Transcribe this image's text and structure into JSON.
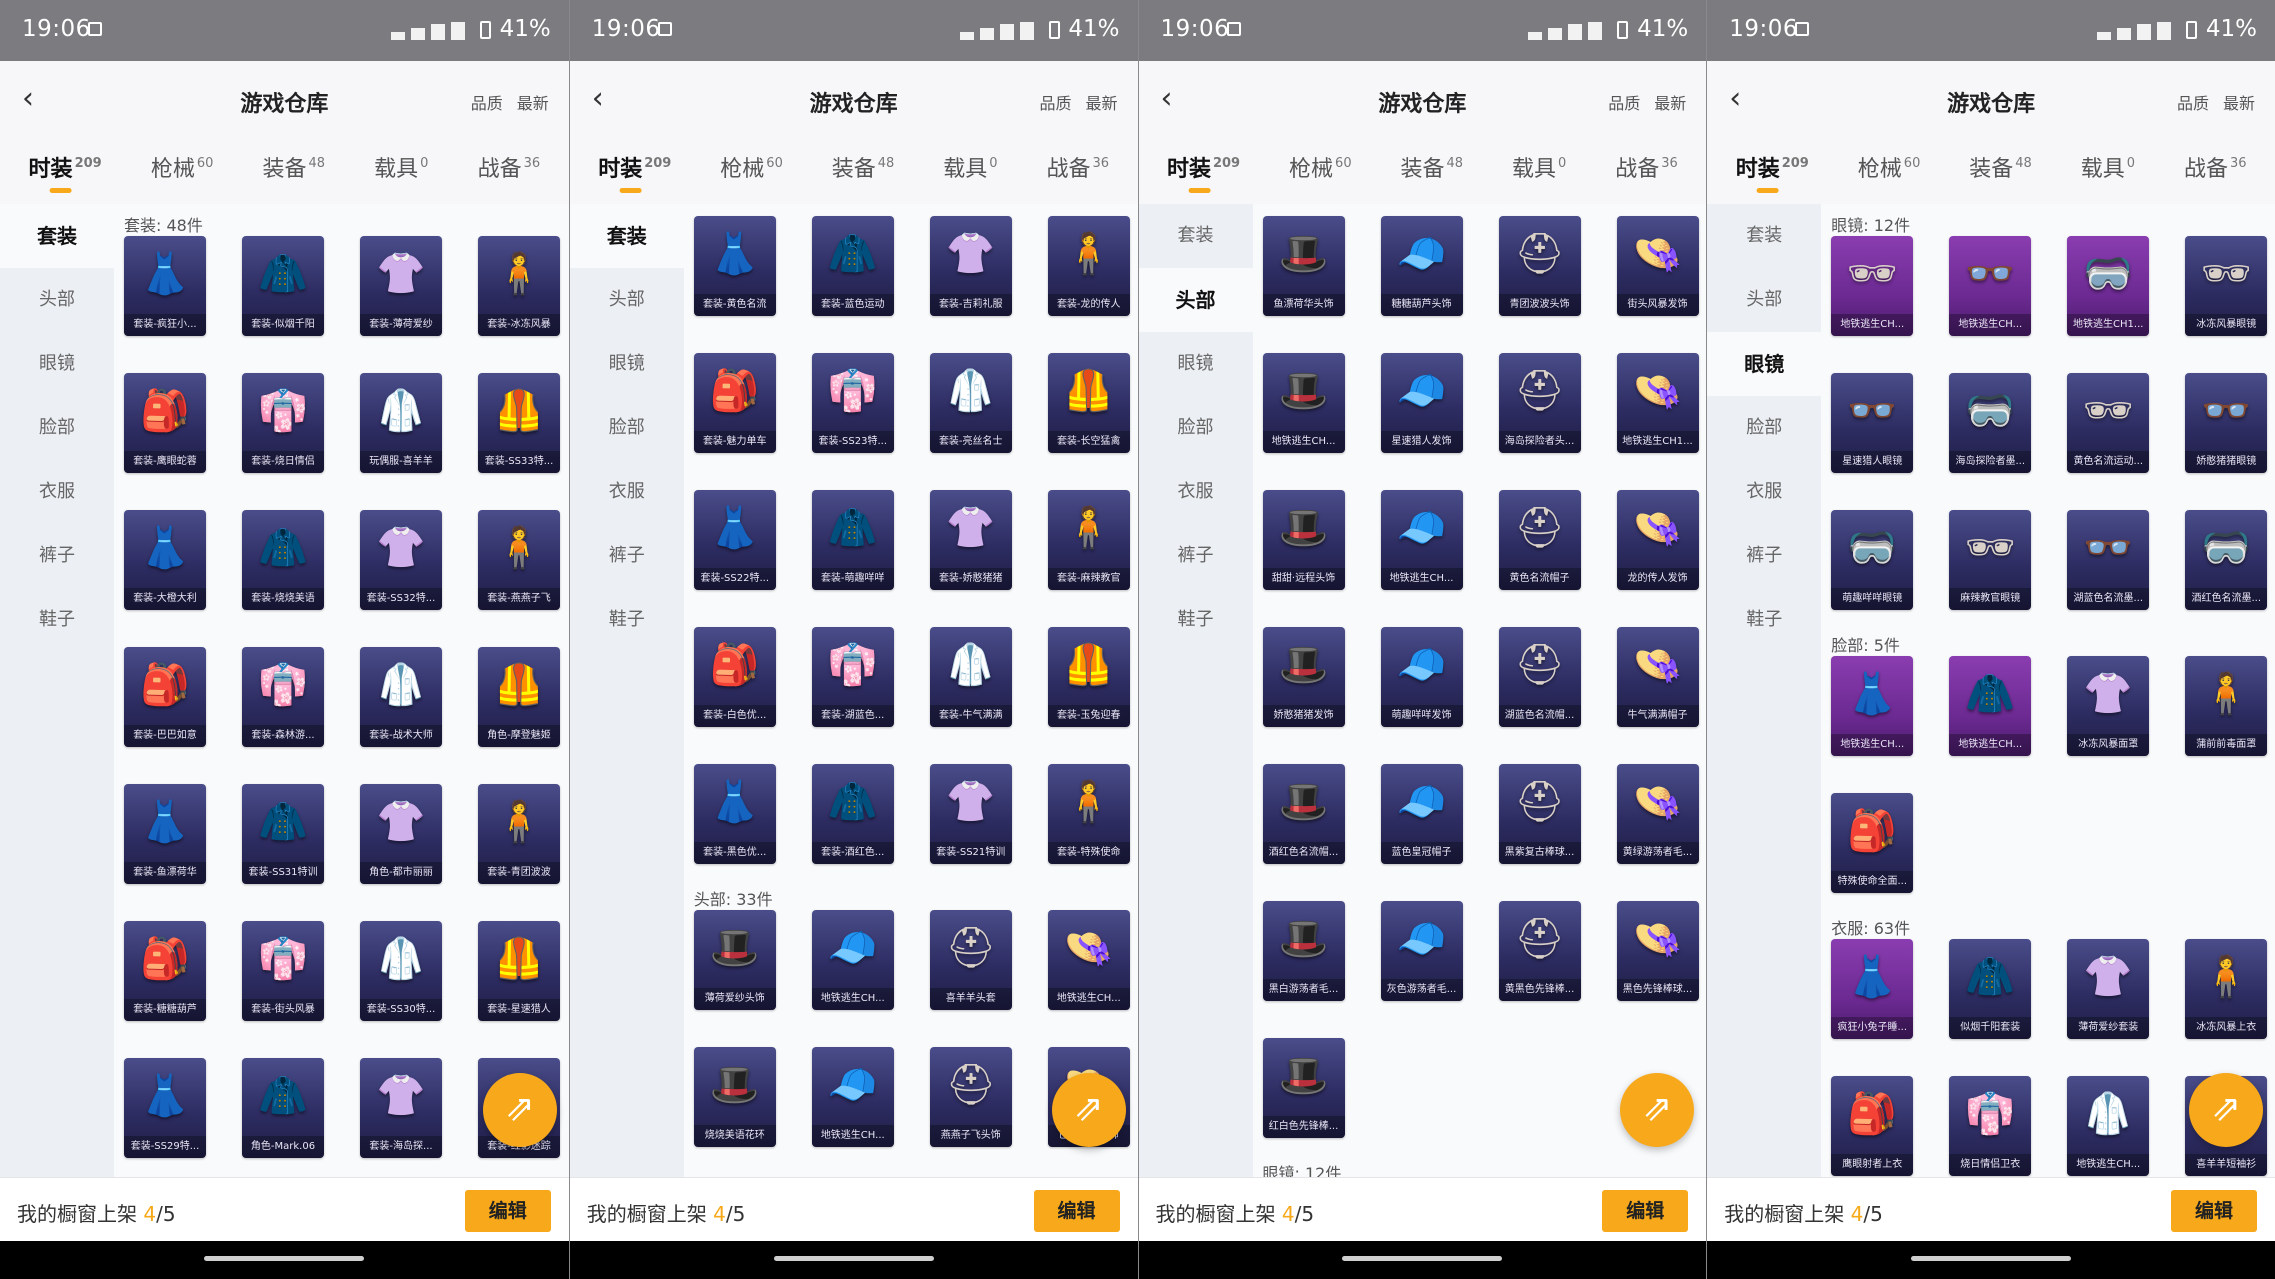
{
  "status": {
    "time": "19:06",
    "battery": "41%"
  },
  "header": {
    "title": "游戏仓库",
    "sort_quality": "品质",
    "sort_newest": "最新"
  },
  "tabs": [
    {
      "label": "时装",
      "count": "209"
    },
    {
      "label": "枪械",
      "count": "60"
    },
    {
      "label": "装备",
      "count": "48"
    },
    {
      "label": "载具",
      "count": "0"
    },
    {
      "label": "战备",
      "count": "36"
    }
  ],
  "sidebar": [
    "套装",
    "头部",
    "眼镜",
    "脸部",
    "衣服",
    "裤子",
    "鞋子"
  ],
  "bottom": {
    "prefix": "我的橱窗上架 ",
    "current": "4",
    "total": "/5",
    "edit_label": "编辑"
  },
  "panels": [
    {
      "active_side": 0,
      "sections": [
        {
          "heading": "套装: 48件",
          "items": [
            "套装-疯狂小...",
            "套装-似烟千阳",
            "套装-薄荷爱纱",
            "套装-冰冻风暴",
            "套装-鹰眼蛇蓉",
            "套装-烧日情侣",
            "玩偶服-喜羊羊",
            "套装-SS33特...",
            "套装-大橙大利",
            "套装-烧烧美语",
            "套装-SS32特...",
            "套装-燕燕子飞",
            "套装-巴巴如意",
            "套装-森林游...",
            "套装-战术大师",
            "角色-摩登魅姬",
            "套装-鱼漂荷华",
            "套装-SS31特训",
            "角色-都市丽丽",
            "套装-青团波波",
            "套装-糖糖葫芦",
            "套装-街头风暴",
            "套装-SS30特...",
            "套装-星速猎人",
            "套装-SS29特...",
            "角色-Mark.06",
            "套装-海岛探...",
            "套装-红影迷踪"
          ]
        }
      ]
    },
    {
      "active_side": 0,
      "sections": [
        {
          "heading": "",
          "items": [
            "套装-黄色名流",
            "套装-蓝色运动",
            "套装-吉莉礼服",
            "套装-龙的传人",
            "套装-魅力单车",
            "套装-SS23特...",
            "套装-亮丝名士",
            "套装-长空猛禽",
            "套装-SS22特...",
            "套装-萌趣咩咩",
            "套装-娇憨猪猪",
            "套装-麻辣教官",
            "套装-白色优...",
            "套装-湖蓝色...",
            "套装-牛气满满",
            "套装-玉兔迎春",
            "套装-黑色优...",
            "套装-酒红色...",
            "套装-SS21特训",
            "套装-特殊使命"
          ]
        },
        {
          "heading": "头部: 33件",
          "items": [
            "薄荷爱纱头饰",
            "地铁逃生CH...",
            "喜羊羊头套",
            "地铁逃生CH...",
            "烧烧美语花环",
            "地铁逃生CH...",
            "燕燕子飞头饰",
            "巴巴如意头饰"
          ]
        }
      ]
    },
    {
      "active_side": 1,
      "sections": [
        {
          "heading": "",
          "items": [
            "鱼漂荷华头饰",
            "糖糖葫芦头饰",
            "青团波波头饰",
            "街头风暴发饰",
            "地铁逃生CH...",
            "星速猎人发饰",
            "海岛探险者头...",
            "地铁逃生CH1...",
            "甜甜·远程头饰",
            "地铁逃生CH...",
            "黄色名流帽子",
            "龙的传人发饰",
            "娇憨猪猪发饰",
            "萌趣咩咩发饰",
            "湖蓝色名流帽...",
            "牛气满满帽子",
            "酒红色名流帽...",
            "蓝色皇冠帽子",
            "黑紫复古棒球...",
            "黄绿游荡者毛...",
            "黑白游荡者毛...",
            "灰色游荡者毛...",
            "黄黑色先锋棒...",
            "黑色先锋棒球...",
            "红白色先锋棒..."
          ]
        },
        {
          "heading": "眼镜: 12件",
          "items": []
        }
      ]
    },
    {
      "active_side": 2,
      "sections": [
        {
          "heading": "眼镜: 12件",
          "items": [
            "地铁逃生CH...",
            "地铁逃生CH...",
            "地铁逃生CH1...",
            "冰冻风暴眼镜",
            "星速猎人眼镜",
            "海岛探险者墨...",
            "黄色名流运动...",
            "娇憨猪猪眼镜",
            "萌趣咩咩眼镜",
            "麻辣教官眼镜",
            "湖蓝色名流墨...",
            "酒红色名流墨..."
          ]
        },
        {
          "heading": "脸部: 5件",
          "items": [
            "地铁逃生CH...",
            "地铁逃生CH...",
            "冰冻风暴面罩",
            "蒲前前毒面罩",
            "特殊使命全面..."
          ]
        },
        {
          "heading": "衣服: 63件",
          "items": [
            "疯狂小兔子睡...",
            "似烟千阳套装",
            "薄荷爱纱套装",
            "冰冻风暴上衣",
            "鹰眼射者上衣",
            "烧日情侣卫衣",
            "地铁逃生CH...",
            "喜羊羊短袖衫"
          ]
        }
      ]
    }
  ]
}
